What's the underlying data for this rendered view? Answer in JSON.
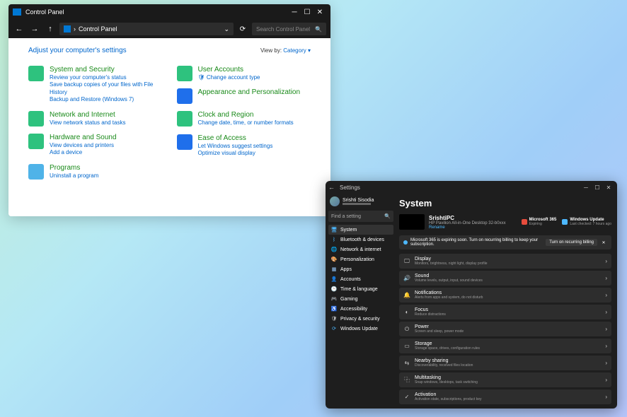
{
  "cp": {
    "title": "Control Panel",
    "address": "Control Panel",
    "search_placeholder": "Search Control Panel",
    "heading": "Adjust your computer's settings",
    "view_by_label": "View by:",
    "view_by_value": "Category",
    "left": [
      {
        "title": "System and Security",
        "subs": [
          "Review your computer's status",
          "Save backup copies of your files with File History",
          "Backup and Restore (Windows 7)"
        ],
        "color": "#2ec27e"
      },
      {
        "title": "Network and Internet",
        "subs": [
          "View network status and tasks"
        ],
        "color": "#2ec27e"
      },
      {
        "title": "Hardware and Sound",
        "subs": [
          "View devices and printers",
          "Add a device"
        ],
        "color": "#2ec27e"
      },
      {
        "title": "Programs",
        "subs": [
          "Uninstall a program"
        ],
        "color": "#4fb3e8"
      }
    ],
    "right": [
      {
        "title": "User Accounts",
        "subs": [
          "Change account type"
        ],
        "color": "#2ec27e",
        "shield": true
      },
      {
        "title": "Appearance and Personalization",
        "subs": [],
        "color": "#1f6feb"
      },
      {
        "title": "Clock and Region",
        "subs": [
          "Change date, time, or number formats"
        ],
        "color": "#2ec27e"
      },
      {
        "title": "Ease of Access",
        "subs": [
          "Let Windows suggest settings",
          "Optimize visual display"
        ],
        "color": "#1f6feb"
      }
    ]
  },
  "st": {
    "title": "Settings",
    "profile_name": "Srishti Sisodia",
    "search_placeholder": "Find a setting",
    "nav": [
      {
        "label": "System",
        "icon": "🖥",
        "active": true,
        "color": "#4db8ff"
      },
      {
        "label": "Bluetooth & devices",
        "icon": "ᛒ",
        "color": "#4db8ff"
      },
      {
        "label": "Network & internet",
        "icon": "🌐",
        "color": "#8cf"
      },
      {
        "label": "Personalization",
        "icon": "🎨",
        "color": "#f6c"
      },
      {
        "label": "Apps",
        "icon": "▦",
        "color": "#9cf"
      },
      {
        "label": "Accounts",
        "icon": "👤",
        "color": "#c99"
      },
      {
        "label": "Time & language",
        "icon": "🕒",
        "color": "#ccc"
      },
      {
        "label": "Gaming",
        "icon": "🎮",
        "color": "#6c6"
      },
      {
        "label": "Accessibility",
        "icon": "♿",
        "color": "#4db8ff"
      },
      {
        "label": "Privacy & security",
        "icon": "🛡",
        "color": "#ccc"
      },
      {
        "label": "Windows Update",
        "icon": "⟳",
        "color": "#4db8ff"
      }
    ],
    "page_title": "System",
    "device": {
      "name": "SrishtiPC",
      "model": "HP Pavilion All-in-One Desktop 32-b0xxx",
      "rename": "Rename"
    },
    "quick": [
      {
        "label": "Microsoft 365",
        "sub": "Expiring",
        "color": "#e74c3c"
      },
      {
        "label": "Windows Update",
        "sub": "Last checked: 7 hours ago",
        "color": "#4db8ff"
      }
    ],
    "banner": {
      "text": "Microsoft 365 is expiring soon. Turn on recurring billing to keep your subscription.",
      "button": "Turn on recurring billing"
    },
    "cards": [
      {
        "title": "Display",
        "sub": "Monitors, brightness, night light, display profile",
        "icon": "🖵"
      },
      {
        "title": "Sound",
        "sub": "Volume levels, output, input, sound devices",
        "icon": "🔊"
      },
      {
        "title": "Notifications",
        "sub": "Alerts from apps and system, do not disturb",
        "icon": "🔔"
      },
      {
        "title": "Focus",
        "sub": "Reduce distractions",
        "icon": "◐"
      },
      {
        "title": "Power",
        "sub": "Screen and sleep, power mode",
        "icon": "⏻"
      },
      {
        "title": "Storage",
        "sub": "Storage space, drives, configuration rules",
        "icon": "▭"
      },
      {
        "title": "Nearby sharing",
        "sub": "Discoverability, received files location",
        "icon": "⇆"
      },
      {
        "title": "Multitasking",
        "sub": "Snap windows, desktops, task switching",
        "icon": "⿻"
      },
      {
        "title": "Activation",
        "sub": "Activation state, subscriptions, product key",
        "icon": "✓"
      }
    ]
  }
}
